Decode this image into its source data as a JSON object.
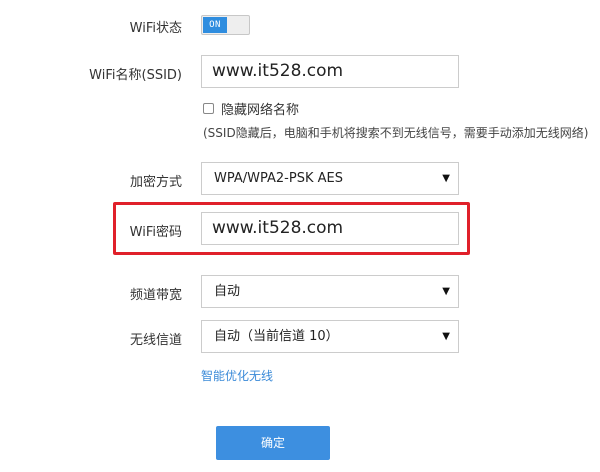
{
  "wifi_status": {
    "label": "WiFi状态",
    "toggle_text": "ON"
  },
  "ssid": {
    "label": "WiFi名称(SSID)",
    "value": "www.it528.com",
    "hide_label": "隐藏网络名称",
    "hint": "(SSID隐藏后，电脑和手机将搜索不到无线信号，需要手动添加无线网络)"
  },
  "encryption": {
    "label": "加密方式",
    "value": "WPA/WPA2-PSK AES"
  },
  "password": {
    "label": "WiFi密码",
    "value": "www.it528.com"
  },
  "bandwidth": {
    "label": "频道带宽",
    "value": "自动"
  },
  "channel": {
    "label": "无线信道",
    "value": "自动（当前信道 10）"
  },
  "optimize_link": "智能优化无线",
  "confirm_label": "确定",
  "colors": {
    "accent": "#3d8fe0",
    "highlight": "#e0202a",
    "link": "#3a8ad8"
  }
}
